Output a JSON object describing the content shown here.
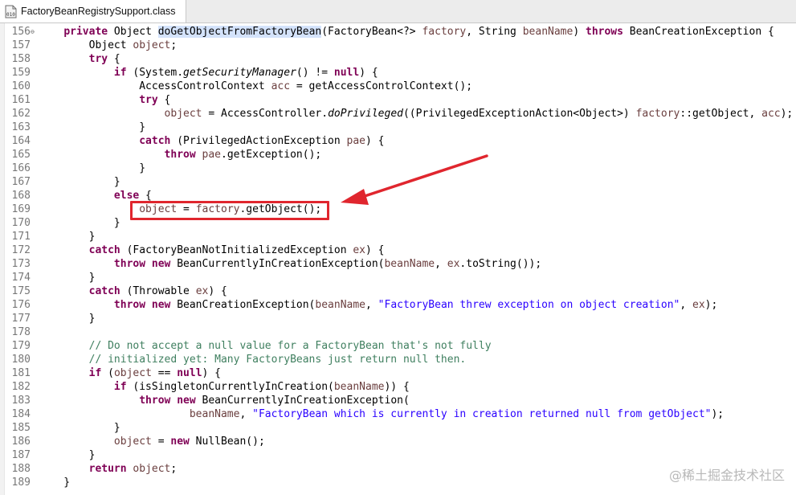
{
  "tab": {
    "title": "FactoryBeanRegistrySupport.class",
    "icon": "class-file-icon"
  },
  "watermark": "@稀土掘金技术社区",
  "colors": {
    "keyword": "#7f0055",
    "string": "#2a00ff",
    "comment": "#3f7f5f",
    "annotation_red": "#e0262e"
  },
  "lines": [
    {
      "n": "156",
      "fold": true,
      "segs": [
        [
          "p",
          "\t"
        ],
        [
          "kw",
          "private"
        ],
        [
          "p",
          " Object "
        ],
        [
          "sel",
          "doGetObjectFromFactoryBean"
        ],
        [
          "p",
          "(FactoryBean<?> "
        ],
        [
          "var",
          "factory"
        ],
        [
          "p",
          ", String "
        ],
        [
          "var",
          "beanName"
        ],
        [
          "p",
          ") "
        ],
        [
          "kw",
          "throws"
        ],
        [
          "p",
          " BeanCreationException {"
        ]
      ]
    },
    {
      "n": "157",
      "segs": [
        [
          "p",
          "\t\tObject "
        ],
        [
          "var",
          "object"
        ],
        [
          "p",
          ";"
        ]
      ]
    },
    {
      "n": "158",
      "segs": [
        [
          "p",
          "\t\t"
        ],
        [
          "kw",
          "try"
        ],
        [
          "p",
          " {"
        ]
      ]
    },
    {
      "n": "159",
      "segs": [
        [
          "p",
          "\t\t\t"
        ],
        [
          "kw",
          "if"
        ],
        [
          "p",
          " (System."
        ],
        [
          "it",
          "getSecurityManager"
        ],
        [
          "p",
          "() != "
        ],
        [
          "kw",
          "null"
        ],
        [
          "p",
          ") {"
        ]
      ]
    },
    {
      "n": "160",
      "segs": [
        [
          "p",
          "\t\t\t\tAccessControlContext "
        ],
        [
          "var",
          "acc"
        ],
        [
          "p",
          " = getAccessControlContext();"
        ]
      ]
    },
    {
      "n": "161",
      "segs": [
        [
          "p",
          "\t\t\t\t"
        ],
        [
          "kw",
          "try"
        ],
        [
          "p",
          " {"
        ]
      ]
    },
    {
      "n": "162",
      "segs": [
        [
          "p",
          "\t\t\t\t\t"
        ],
        [
          "var",
          "object"
        ],
        [
          "p",
          " = AccessController."
        ],
        [
          "it",
          "doPrivileged"
        ],
        [
          "p",
          "((PrivilegedExceptionAction<Object>) "
        ],
        [
          "var",
          "factory"
        ],
        [
          "p",
          "::getObject, "
        ],
        [
          "var",
          "acc"
        ],
        [
          "p",
          ");"
        ]
      ]
    },
    {
      "n": "163",
      "segs": [
        [
          "p",
          "\t\t\t\t}"
        ]
      ]
    },
    {
      "n": "164",
      "segs": [
        [
          "p",
          "\t\t\t\t"
        ],
        [
          "kw",
          "catch"
        ],
        [
          "p",
          " (PrivilegedActionException "
        ],
        [
          "var",
          "pae"
        ],
        [
          "p",
          ") {"
        ]
      ]
    },
    {
      "n": "165",
      "segs": [
        [
          "p",
          "\t\t\t\t\t"
        ],
        [
          "kw",
          "throw"
        ],
        [
          "p",
          " "
        ],
        [
          "var",
          "pae"
        ],
        [
          "p",
          ".getException();"
        ]
      ]
    },
    {
      "n": "166",
      "segs": [
        [
          "p",
          "\t\t\t\t}"
        ]
      ]
    },
    {
      "n": "167",
      "segs": [
        [
          "p",
          "\t\t\t}"
        ]
      ]
    },
    {
      "n": "168",
      "segs": [
        [
          "p",
          "\t\t\t"
        ],
        [
          "kw",
          "else"
        ],
        [
          "p",
          " {"
        ]
      ]
    },
    {
      "n": "169",
      "segs": [
        [
          "p",
          "\t\t\t\t"
        ],
        [
          "var",
          "object"
        ],
        [
          "p",
          " = "
        ],
        [
          "var",
          "factory"
        ],
        [
          "p",
          ".getObject();"
        ]
      ]
    },
    {
      "n": "170",
      "segs": [
        [
          "p",
          "\t\t\t}"
        ]
      ]
    },
    {
      "n": "171",
      "segs": [
        [
          "p",
          "\t\t}"
        ]
      ]
    },
    {
      "n": "172",
      "segs": [
        [
          "p",
          "\t\t"
        ],
        [
          "kw",
          "catch"
        ],
        [
          "p",
          " (FactoryBeanNotInitializedException "
        ],
        [
          "var",
          "ex"
        ],
        [
          "p",
          ") {"
        ]
      ]
    },
    {
      "n": "173",
      "segs": [
        [
          "p",
          "\t\t\t"
        ],
        [
          "kw",
          "throw"
        ],
        [
          "p",
          " "
        ],
        [
          "kw",
          "new"
        ],
        [
          "p",
          " BeanCurrentlyInCreationException("
        ],
        [
          "var",
          "beanName"
        ],
        [
          "p",
          ", "
        ],
        [
          "var",
          "ex"
        ],
        [
          "p",
          ".toString());"
        ]
      ]
    },
    {
      "n": "174",
      "segs": [
        [
          "p",
          "\t\t}"
        ]
      ]
    },
    {
      "n": "175",
      "segs": [
        [
          "p",
          "\t\t"
        ],
        [
          "kw",
          "catch"
        ],
        [
          "p",
          " (Throwable "
        ],
        [
          "var",
          "ex"
        ],
        [
          "p",
          ") {"
        ]
      ]
    },
    {
      "n": "176",
      "segs": [
        [
          "p",
          "\t\t\t"
        ],
        [
          "kw",
          "throw"
        ],
        [
          "p",
          " "
        ],
        [
          "kw",
          "new"
        ],
        [
          "p",
          " BeanCreationException("
        ],
        [
          "var",
          "beanName"
        ],
        [
          "p",
          ", "
        ],
        [
          "str",
          "\"FactoryBean threw exception on object creation\""
        ],
        [
          "p",
          ", "
        ],
        [
          "var",
          "ex"
        ],
        [
          "p",
          ");"
        ]
      ]
    },
    {
      "n": "177",
      "segs": [
        [
          "p",
          "\t\t}"
        ]
      ]
    },
    {
      "n": "178",
      "segs": []
    },
    {
      "n": "179",
      "segs": [
        [
          "p",
          "\t\t"
        ],
        [
          "cmt",
          "// Do not accept a null value for a FactoryBean that's not fully"
        ]
      ]
    },
    {
      "n": "180",
      "segs": [
        [
          "p",
          "\t\t"
        ],
        [
          "cmt",
          "// initialized yet: Many FactoryBeans just return null then."
        ]
      ]
    },
    {
      "n": "181",
      "segs": [
        [
          "p",
          "\t\t"
        ],
        [
          "kw",
          "if"
        ],
        [
          "p",
          " ("
        ],
        [
          "var",
          "object"
        ],
        [
          "p",
          " == "
        ],
        [
          "kw",
          "null"
        ],
        [
          "p",
          ") {"
        ]
      ]
    },
    {
      "n": "182",
      "segs": [
        [
          "p",
          "\t\t\t"
        ],
        [
          "kw",
          "if"
        ],
        [
          "p",
          " (isSingletonCurrentlyInCreation("
        ],
        [
          "var",
          "beanName"
        ],
        [
          "p",
          ")) {"
        ]
      ]
    },
    {
      "n": "183",
      "segs": [
        [
          "p",
          "\t\t\t\t"
        ],
        [
          "kw",
          "throw"
        ],
        [
          "p",
          " "
        ],
        [
          "kw",
          "new"
        ],
        [
          "p",
          " BeanCurrentlyInCreationException("
        ]
      ]
    },
    {
      "n": "184",
      "segs": [
        [
          "p",
          "\t\t\t\t\t\t"
        ],
        [
          "var",
          "beanName"
        ],
        [
          "p",
          ", "
        ],
        [
          "str",
          "\"FactoryBean which is currently in creation returned null from getObject\""
        ],
        [
          "p",
          ");"
        ]
      ]
    },
    {
      "n": "185",
      "segs": [
        [
          "p",
          "\t\t\t}"
        ]
      ]
    },
    {
      "n": "186",
      "segs": [
        [
          "p",
          "\t\t\t"
        ],
        [
          "var",
          "object"
        ],
        [
          "p",
          " = "
        ],
        [
          "kw",
          "new"
        ],
        [
          "p",
          " NullBean();"
        ]
      ]
    },
    {
      "n": "187",
      "segs": [
        [
          "p",
          "\t\t}"
        ]
      ]
    },
    {
      "n": "188",
      "segs": [
        [
          "p",
          "\t\t"
        ],
        [
          "kw",
          "return"
        ],
        [
          "p",
          " "
        ],
        [
          "var",
          "object"
        ],
        [
          "p",
          ";"
        ]
      ]
    },
    {
      "n": "189",
      "segs": [
        [
          "p",
          "\t}"
        ]
      ]
    }
  ]
}
